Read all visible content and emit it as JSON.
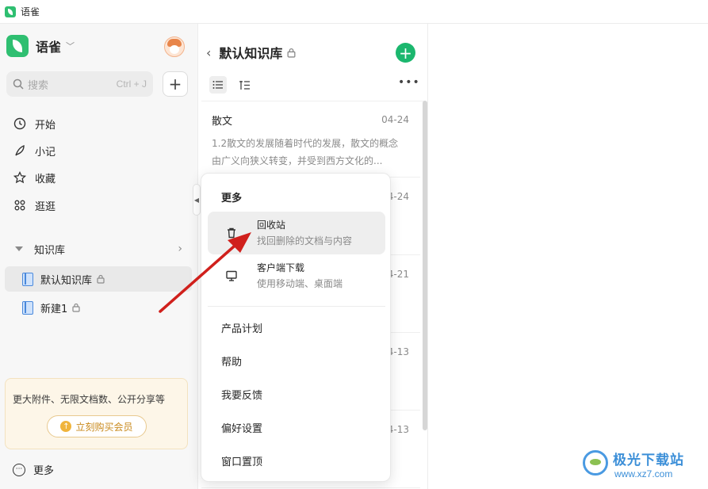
{
  "window": {
    "title": "语雀"
  },
  "sidebar": {
    "brand": {
      "name": "语雀"
    },
    "search": {
      "placeholder": "搜索",
      "shortcut": "Ctrl + J"
    },
    "nav": [
      {
        "label": "开始",
        "icon": "clock-icon"
      },
      {
        "label": "小记",
        "icon": "feather-icon"
      },
      {
        "label": "收藏",
        "icon": "star-icon"
      },
      {
        "label": "逛逛",
        "icon": "grid-icon"
      }
    ],
    "kb_section": {
      "label": "知识库"
    },
    "kb_items": [
      {
        "label": "默认知识库",
        "active": true
      },
      {
        "label": "新建1",
        "active": false
      }
    ],
    "promo": {
      "text": "更大附件、无限文档数、公开分享等",
      "button": "立刻购买会员"
    },
    "more": {
      "label": "更多"
    }
  },
  "doclist": {
    "title": "默认知识库",
    "docs": [
      {
        "title": "散文",
        "date": "04-24",
        "snippet": "1.2散文的发展随着时代的发展，散文的概念由广义向狭义转变，并受到西方文化的..."
      },
      {
        "title": "",
        "date": "04-24",
        "snippet": ""
      },
      {
        "title": "",
        "date": "04-21",
        "snippet": ""
      },
      {
        "title": "",
        "date": "04-13",
        "snippet": ""
      },
      {
        "title": "",
        "date": "04-13",
        "snippet": ""
      }
    ]
  },
  "menu": {
    "title": "更多",
    "rich_items": [
      {
        "title": "回收站",
        "subtitle": "找回删除的文档与内容",
        "icon": "trash-icon",
        "active": true
      },
      {
        "title": "客户端下载",
        "subtitle": "使用移动端、桌面端",
        "icon": "monitor-icon",
        "active": false
      }
    ],
    "plain_items": [
      "产品计划",
      "帮助",
      "我要反馈",
      "偏好设置",
      "窗口置顶"
    ]
  },
  "watermark": {
    "name": "极光下载站",
    "url": "www.xz7.com"
  },
  "colors": {
    "brand_green": "#1bb76e",
    "annotation_arrow": "#d0201c",
    "book_blue": "#4a89dc"
  }
}
